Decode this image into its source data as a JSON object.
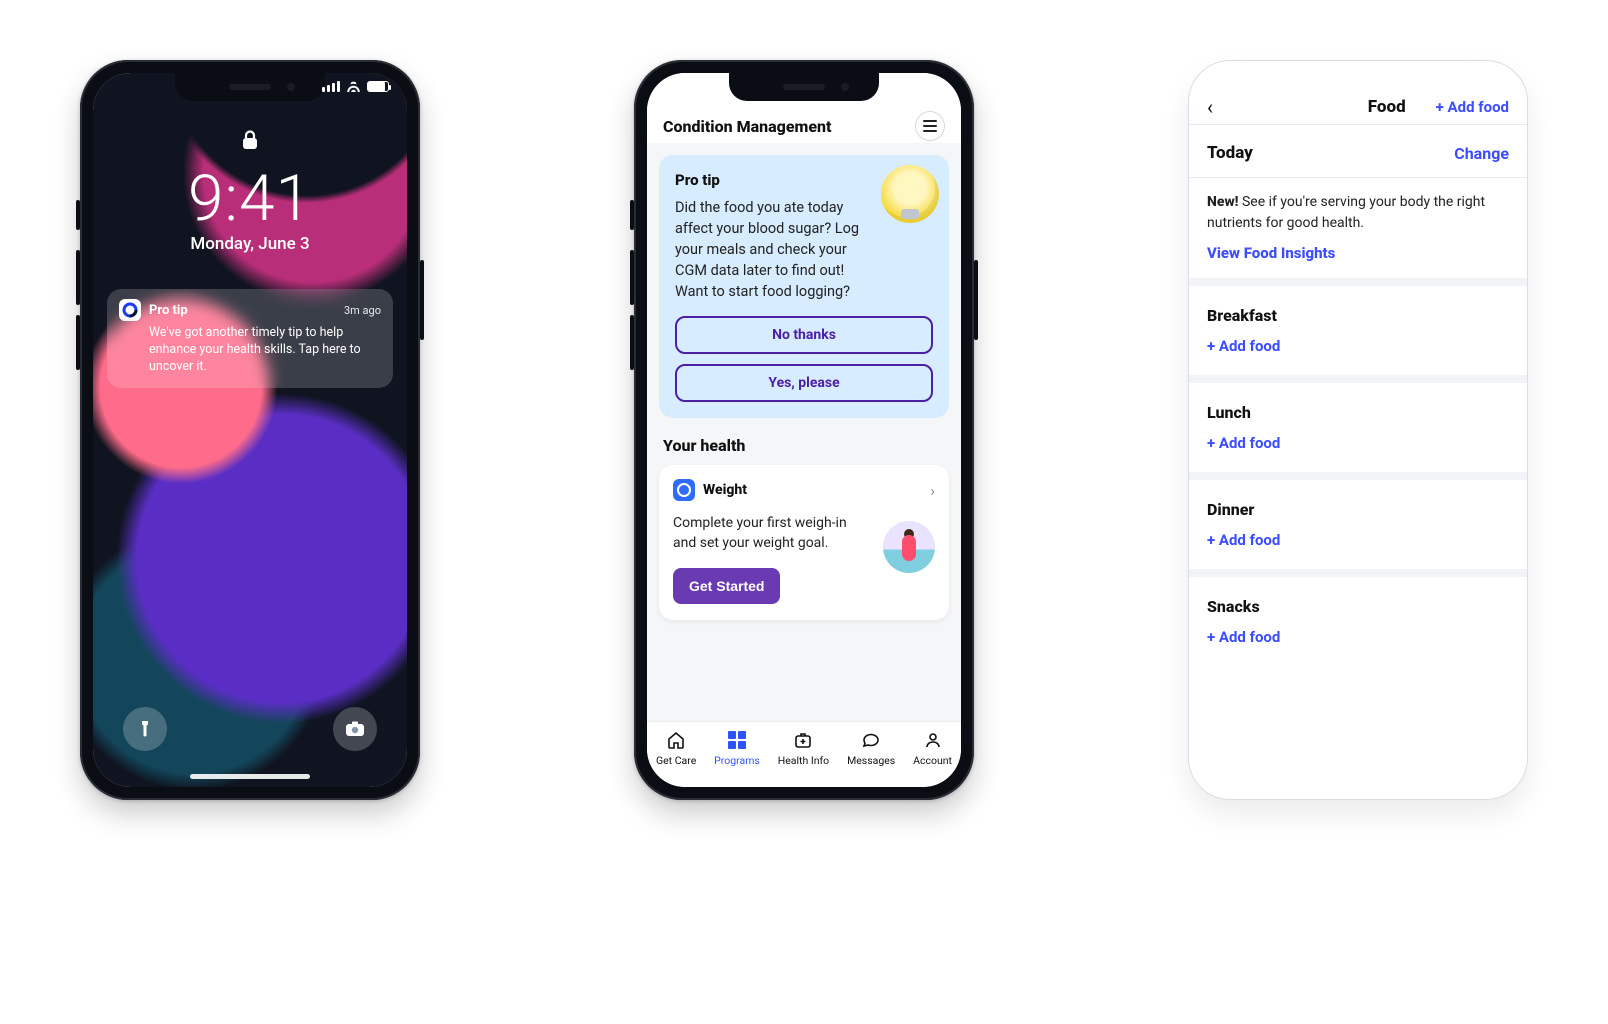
{
  "lock": {
    "time": "9:41",
    "date": "Monday, June 3",
    "notification": {
      "title": "Pro tip",
      "time_ago": "3m ago",
      "body": "We've got another timely tip to help enhance your health skills. Tap here to uncover it."
    }
  },
  "cm": {
    "header_title": "Condition Management",
    "tip": {
      "title": "Pro tip",
      "body": "Did the food you ate today affect your blood sugar? Log your meals and check your CGM data later to find out! Want to start food logging?",
      "no_label": "No thanks",
      "yes_label": "Yes, please"
    },
    "your_health_heading": "Your health",
    "weight_card": {
      "title": "Weight",
      "body": "Complete your first weigh-in and set your weight goal.",
      "cta": "Get Started"
    },
    "tabs": [
      {
        "label": "Get Care"
      },
      {
        "label": "Programs"
      },
      {
        "label": "Health Info"
      },
      {
        "label": "Messages"
      },
      {
        "label": "Account"
      }
    ]
  },
  "food": {
    "title": "Food",
    "add_food_top": "+ Add food",
    "today_label": "Today",
    "change_label": "Change",
    "insight_prefix": "New!",
    "insight_rest": " See if you're serving your body the right nutrients for good health.",
    "insight_link": "View Food Insights",
    "meals": [
      {
        "name": "Breakfast",
        "add": "+ Add food"
      },
      {
        "name": "Lunch",
        "add": "+ Add food"
      },
      {
        "name": "Dinner",
        "add": "+ Add food"
      },
      {
        "name": "Snacks",
        "add": "+ Add food"
      }
    ]
  }
}
